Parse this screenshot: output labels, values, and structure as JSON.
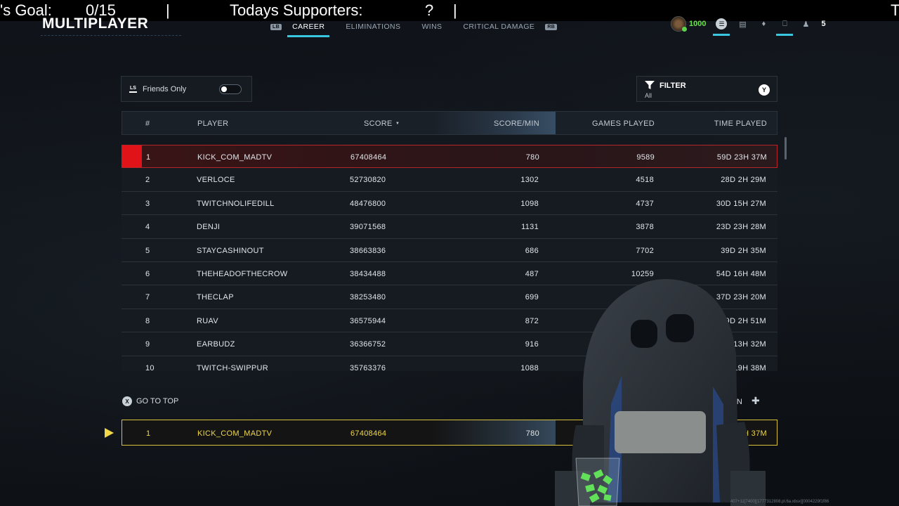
{
  "overlay": {
    "goal_label": "'s Goal:",
    "goal_value": "0/15",
    "separator": "|",
    "supporters_label": "Todays Supporters:",
    "supporters_value": "?",
    "trailing": "T"
  },
  "header": {
    "title": "MULTIPLAYER",
    "left_bumper": "LB",
    "right_bumper": "RB",
    "tabs": [
      "CAREER",
      "ELIMINATIONS",
      "WINS",
      "CRITICAL DAMAGE"
    ],
    "active_tab": "CAREER"
  },
  "hud": {
    "credits": "1000",
    "party_count": "5",
    "icons": [
      "rank-emblem-icon",
      "chat-icon",
      "social-icon",
      "notifications-icon",
      "controller-icon",
      "party-icon"
    ]
  },
  "controls": {
    "friends_button_glyph": "LS",
    "friends_label": "Friends Only",
    "friends_enabled": false,
    "filter_label": "FILTER",
    "filter_value": "All",
    "filter_button_glyph": "Y"
  },
  "table": {
    "columns": [
      "#",
      "PLAYER",
      "SCORE",
      "SCORE/MIN",
      "GAMES PLAYED",
      "TIME PLAYED"
    ],
    "sorted_by": "SCORE",
    "rows": [
      {
        "rank": "1",
        "player": "KICK_COM_MADTV",
        "score": "67408464",
        "spm": "780",
        "games": "9589",
        "time": "59D 23H 37M"
      },
      {
        "rank": "2",
        "player": "VERLOCE",
        "score": "52730820",
        "spm": "1302",
        "games": "4518",
        "time": "28D 2H 29M"
      },
      {
        "rank": "3",
        "player": "TWITCHNOLIFEDILL",
        "score": "48476800",
        "spm": "1098",
        "games": "4737",
        "time": "30D 15H 27M"
      },
      {
        "rank": "4",
        "player": "DENJI",
        "score": "39071568",
        "spm": "1131",
        "games": "3878",
        "time": "23D 23H 28M"
      },
      {
        "rank": "5",
        "player": "STAYCASHINOUT",
        "score": "38663836",
        "spm": "686",
        "games": "7702",
        "time": "39D 2H 35M"
      },
      {
        "rank": "6",
        "player": "THEHEADOFTHECROW",
        "score": "38434488",
        "spm": "487",
        "games": "10259",
        "time": "54D 16H 48M"
      },
      {
        "rank": "7",
        "player": "THECLAP",
        "score": "38253480",
        "spm": "699",
        "games": "",
        "time": "37D 23H 20M"
      },
      {
        "rank": "8",
        "player": "RUAV",
        "score": "36575944",
        "spm": "872",
        "games": "",
        "time": "29D 2H 51M"
      },
      {
        "rank": "9",
        "player": "EARBUDZ",
        "score": "36366752",
        "spm": "916",
        "games": "",
        "time": "30D 13H 32M"
      },
      {
        "rank": "10",
        "player": "TWITCH-SWIPPUR",
        "score": "35763376",
        "spm": "1088",
        "games": "",
        "time": "2 19H 38M"
      }
    ]
  },
  "footer": {
    "go_to_top_glyph": "X",
    "go_to_top": "GO TO TOP",
    "page_down": "DOWN"
  },
  "self_row": {
    "rank": "1",
    "player": "KICK_COM_MADTV",
    "score": "67408464",
    "spm": "780",
    "time": "3D 23H 37M"
  },
  "build": "407+11[7400][1777312808.pl.6a.xbsx][0004229f1f86"
}
